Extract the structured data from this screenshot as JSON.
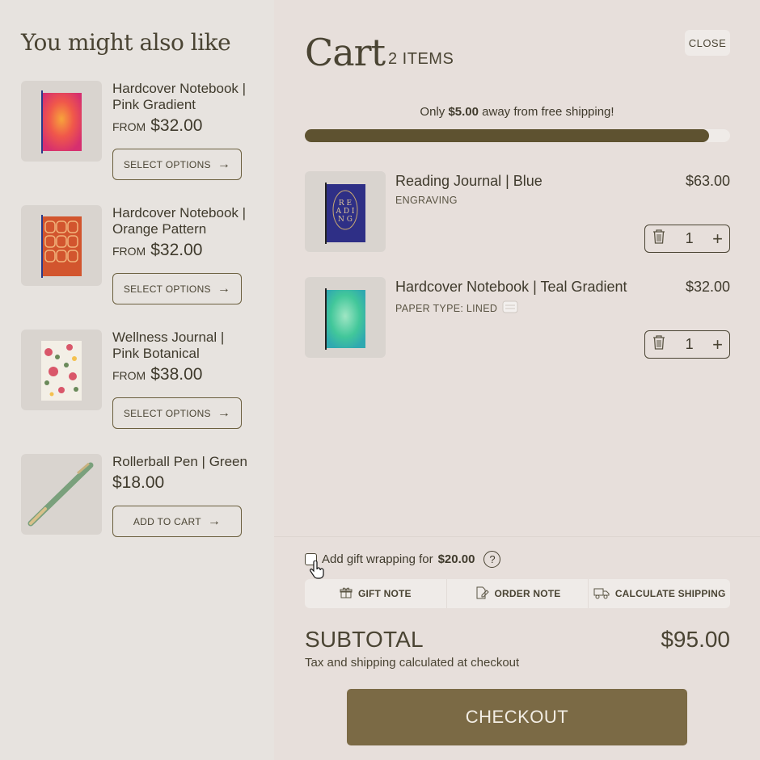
{
  "recommendations": {
    "title": "You might also like",
    "items": [
      {
        "name": "Hardcover Notebook | Pink Gradient",
        "from": "FROM",
        "price": "$32.00",
        "button": "SELECT OPTIONS"
      },
      {
        "name": "Hardcover Notebook | Orange Pattern",
        "from": "FROM",
        "price": "$32.00",
        "button": "SELECT OPTIONS"
      },
      {
        "name": "Wellness Journal | Pink Botanical",
        "from": "FROM",
        "price": "$38.00",
        "button": "SELECT OPTIONS"
      },
      {
        "name": "Rollerball Pen | Green",
        "from": "",
        "price": "$18.00",
        "button": "ADD TO CART"
      }
    ]
  },
  "cart": {
    "title": "Cart",
    "count": "2 ITEMS",
    "close": "CLOSE",
    "shipping": {
      "prefix": "Only",
      "amount": "$5.00",
      "suffix": "away from free shipping!",
      "progress": 0.95
    },
    "items": [
      {
        "name": "Reading Journal | Blue",
        "option": "ENGRAVING",
        "price": "$63.00",
        "qty": "1"
      },
      {
        "name": "Hardcover Notebook | Teal Gradient",
        "option": "PAPER TYPE: LINED",
        "price": "$32.00",
        "qty": "1"
      }
    ],
    "gift_wrap": {
      "label": "Add gift wrapping for",
      "price": "$20.00",
      "help": "?"
    },
    "tabs": {
      "gift_note": "GIFT NOTE",
      "order_note": "ORDER NOTE",
      "shipping": "CALCULATE SHIPPING"
    },
    "subtotal_label": "SUBTOTAL",
    "subtotal": "$95.00",
    "tax_note": "Tax and shipping calculated at checkout",
    "checkout": "CHECKOUT"
  },
  "colors": {
    "accent": "#5e5230",
    "checkout_bg": "#7b6a45",
    "bg_left": "#e7e3df",
    "bg_right": "#e7dfdb"
  }
}
